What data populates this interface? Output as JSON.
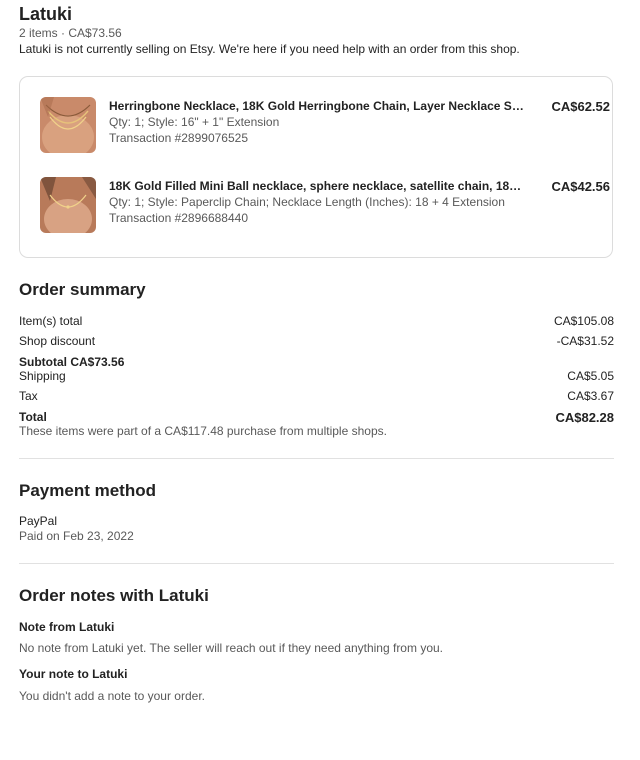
{
  "shop": {
    "name": "Latuki",
    "meta": "2 items · CA$73.56",
    "notice": "Latuki is not currently selling on Etsy. We're here if you need help with an order from this shop."
  },
  "items": [
    {
      "title": "Herringbone Necklace, 18K Gold Herringbone Chain, Layer Necklace Set,...",
      "detail": "Qty: 1; Style: 16\" + 1\" Extension",
      "transaction": "Transaction #2899076525",
      "price": "CA$62.52",
      "thumb_icon": "necklace-photo"
    },
    {
      "title": "18K Gold Filled Mini Ball necklace, sphere necklace, satellite chain, 18k g...",
      "detail": "Qty: 1; Style: Paperclip Chain; Necklace Length (Inches): 18 + 4 Extension",
      "transaction": "Transaction #2896688440",
      "price": "CA$42.56",
      "thumb_icon": "necklace-photo"
    }
  ],
  "summary": {
    "title": "Order summary",
    "items_total_label": "Item(s) total",
    "items_total_value": "CA$105.08",
    "shop_discount_label": "Shop discount",
    "shop_discount_value": "-CA$31.52",
    "subtotal": "Subtotal CA$73.56",
    "shipping_label": "Shipping",
    "shipping_value": "CA$5.05",
    "tax_label": "Tax",
    "tax_value": "CA$3.67",
    "total_label": "Total",
    "total_value": "CA$82.28",
    "note": "These items were part of a CA$117.48 purchase from multiple shops."
  },
  "payment": {
    "title": "Payment method",
    "method": "PayPal",
    "paid_on": "Paid on Feb 23, 2022"
  },
  "notes": {
    "title": "Order notes with Latuki",
    "seller_heading": "Note from Latuki",
    "seller_text": "No note from Latuki yet. The seller will reach out if they need anything from you.",
    "buyer_heading": "Your note to Latuki",
    "buyer_text": "You didn't add a note to your order."
  },
  "colors": {
    "text": "#222222",
    "muted": "#595959",
    "border": "#dcdcdc",
    "divider": "#e1e1e1"
  }
}
